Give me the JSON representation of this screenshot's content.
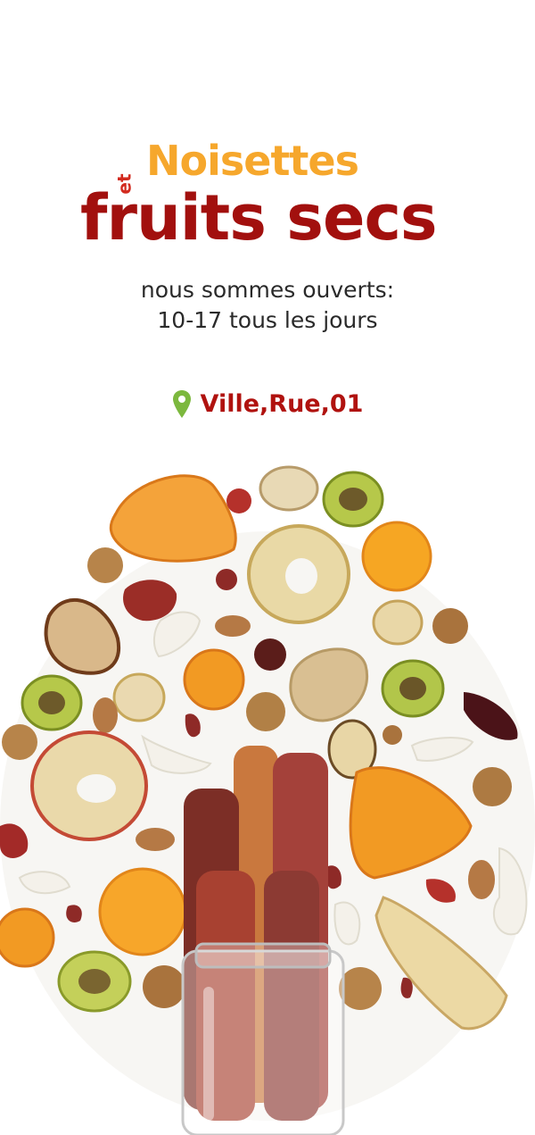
{
  "logo": {
    "et": "et",
    "noisettes": "Noisettes",
    "fruits_secs": "fruits secs"
  },
  "hours": {
    "line1": "nous sommes ouverts:",
    "line2": "10-17 tous les jours"
  },
  "address": {
    "icon": "location-pin-icon",
    "text": "Ville,Rue,01"
  },
  "colors": {
    "noisettes": "#f6a72c",
    "fruits_secs": "#a2100e",
    "et": "#d22a1e",
    "address_text": "#b0120f",
    "pin": "#7cb83e",
    "hours_text": "#2a2a2a"
  }
}
